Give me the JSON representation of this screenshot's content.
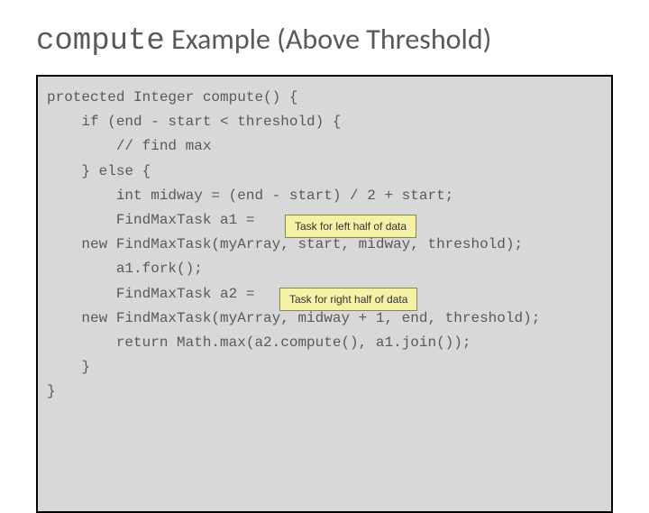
{
  "title": {
    "mono": "compute",
    "rest": " Example (Above Threshold)"
  },
  "code": {
    "l1": "protected Integer compute() {",
    "l2": "    if (end - start < threshold) {",
    "l3": "        // find max",
    "l4": "    } else {",
    "l5": "        int midway = (end - start) / 2 + start;",
    "l6": "        FindMaxTask a1 =",
    "l7": "    new FindMaxTask(myArray, start, midway, threshold);",
    "l8": "        a1.fork();",
    "l9": "        FindMaxTask a2 =",
    "l10": "    new FindMaxTask(myArray, midway + 1, end, threshold);",
    "l11": "        return Math.max(a2.compute(), a1.join());",
    "l12": "    }",
    "l13": "}"
  },
  "callouts": {
    "left": "Task for left half of data",
    "right": "Task for right half of data"
  }
}
